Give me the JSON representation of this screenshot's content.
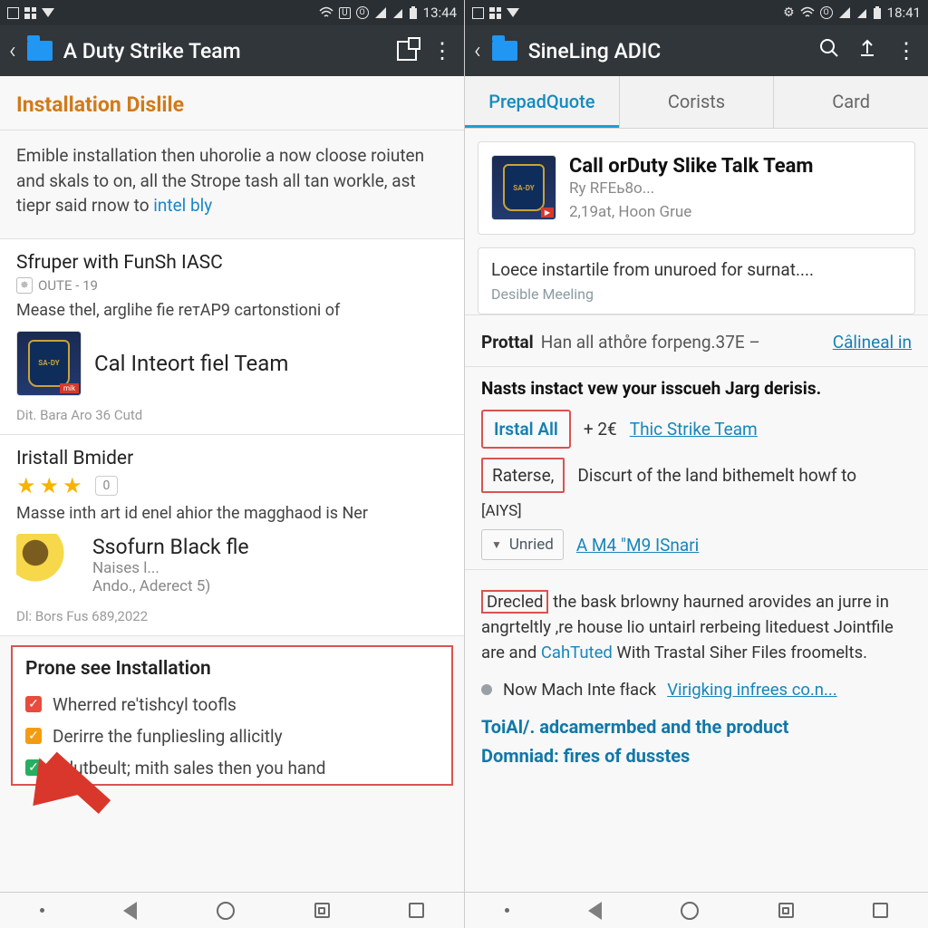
{
  "left": {
    "status": {
      "time": "13:44"
    },
    "appbar": {
      "title": "A Duty Strike Team"
    },
    "section_header": "Installation Dislile",
    "intro": {
      "text_a": "Emible installation then uhorolie a now cloose roiuten and skals to on, all the Strope tash all tan workle, ast tiepr said rnow to ",
      "link": "intel bly"
    },
    "card1": {
      "title": "Sfruper with FunSh IASC",
      "badge": "OUTE - 19",
      "desc": "Mease thel, arglihe fie rетAP9 cartonstioni of",
      "appname": "Cal Inteort fiel Team",
      "appicon_corner": "mik",
      "appicon_shield": "SA-DY",
      "foot": "Dit. Bara Aro 36 Cutd"
    },
    "card2": {
      "title": "Iristall Bmider",
      "rate_btn": "0",
      "desc": "Masse inth art id enel ahior the magghaod is Ner",
      "subname": "Ssofurn Black fle",
      "subsub1": "Naises l...",
      "subsub2": "Ando., Aderect 5)",
      "foot": "Dl: Bors Fus 689,2022"
    },
    "install": {
      "header": "Prone see Installation",
      "opt1": "Wherred re'tishcyl toofls",
      "opt2": "Derirre the funpliesling allicitly",
      "opt3": "Adutbeult; mith sales then you hand"
    }
  },
  "right": {
    "status": {
      "time": "18:41"
    },
    "appbar": {
      "title": "SineLing ADIC"
    },
    "tabs": {
      "t1": "PrepadQuote",
      "t2": "Corists",
      "t3": "Card"
    },
    "app": {
      "title": "Call orDuty Slike Talk Team",
      "publisher": "Ry RFEь8o...",
      "date": "2,19at, Hoon Grue",
      "shield": "SA-DY"
    },
    "info": {
      "l1": "Loece instartile from unuroed for surnat....",
      "l2": "Desible Meeling"
    },
    "protal": {
      "k": "Prottal",
      "v": "Han all atho̊re forpeng.37E –",
      "link": "Câlineal in"
    },
    "steps": {
      "h": "Nasts instact vew your isscueh Jarg derisis.",
      "install_all": "Irstal All",
      "plus2": "+ 2€",
      "strike_link": "Thic Strike Team",
      "raterse": "Raterse,",
      "raterse_after": "Discurt of the land bithemelt howf to",
      "ays": "[AIYS]",
      "dd": "Unried",
      "dd_after": "A M4 \"M9 ISnari"
    },
    "long": {
      "box": "Drecled",
      "text": " the bask brlowny haurned arovides an jurre in angrteltly ,re house lio untairl rerbeing liteduest Jointfile are and ",
      "link": "CahTuted",
      "tail": " With Trastal Siher Files froomelts."
    },
    "bullet": {
      "pre": "Now Mach Inte fłack ",
      "link": "Virigking infrees co.n..."
    },
    "bluehead1": "ToiAl/.  adcamermbed and the product",
    "bluehead2": "Domniad:  fires of dusstes"
  }
}
